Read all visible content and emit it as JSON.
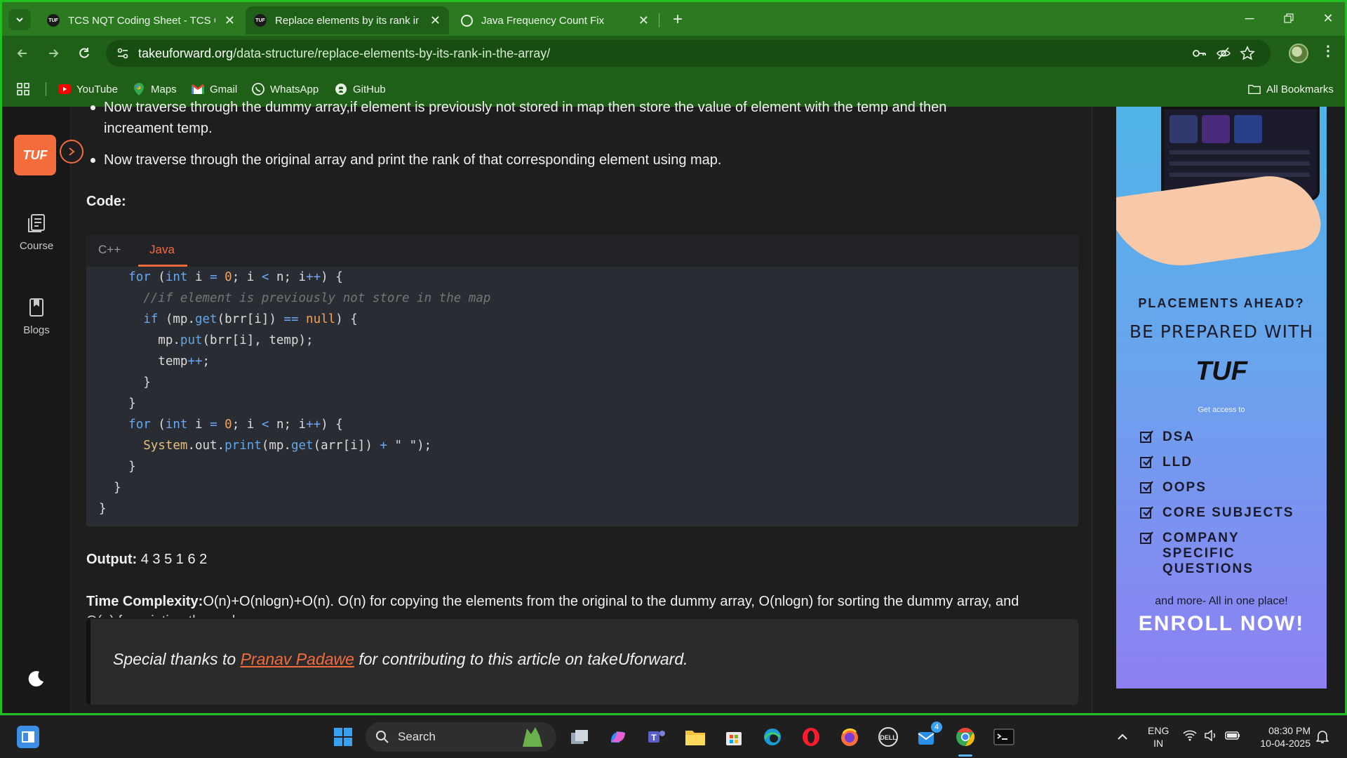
{
  "browser": {
    "tabs": [
      {
        "title": "TCS NQT Coding Sheet - TCS Coding Questions",
        "favicon": "TUF",
        "active": false
      },
      {
        "title": "Replace elements by its rank in the array",
        "favicon": "TUF",
        "active": true
      },
      {
        "title": "Java Frequency Count Fix",
        "favicon": "openai-icon",
        "active": false
      }
    ],
    "url_host": "takeuforward.org",
    "url_path": "/data-structure/replace-elements-by-its-rank-in-the-array/",
    "bookmarks": [
      {
        "label": "YouTube",
        "icon": "youtube-icon"
      },
      {
        "label": "Maps",
        "icon": "maps-icon"
      },
      {
        "label": "Gmail",
        "icon": "gmail-icon"
      },
      {
        "label": "WhatsApp",
        "icon": "whatsapp-icon"
      },
      {
        "label": "GitHub",
        "icon": "github-icon"
      }
    ],
    "all_bookmarks": "All Bookmarks"
  },
  "sidenav": {
    "logo": "TUF",
    "items": [
      {
        "label": "Course"
      },
      {
        "label": "Blogs"
      }
    ]
  },
  "article": {
    "bullet1_line1": "Now traverse through the dummy array,if element is previously not stored in map then store the value of element with the temp and then",
    "bullet1_line2": "increament temp.",
    "bullet2": "Now traverse through the original array and print the rank of that corresponding element using map.",
    "code_heading": "Code:",
    "code_tabs": [
      "C++",
      "Java"
    ],
    "active_code_tab": "Java",
    "output_label": "Output:",
    "output_value": " 4 3 5 1 6 2",
    "tc_label": "Time Complexity:",
    "tc_text": "O(n)+O(nlogn)+O(n). O(n) for copying the elements from the original to the dummy array, O(nlogn) for sorting the dummy array, and",
    "tc_cut": "O(n) for printing the rank",
    "thanks_pre": "Special thanks to ",
    "thanks_link": "Pranav Padawe",
    "thanks_post": " for contributing to this article on takeUforward."
  },
  "ad": {
    "q": "PLACEMENTS AHEAD?",
    "prepared": "BE PREPARED WITH",
    "brand": "TUF",
    "access": "Get access to",
    "items": [
      "DSA",
      "LLD",
      "OOPS",
      "CORE SUBJECTS",
      "COMPANY SPECIFIC QUESTIONS"
    ],
    "more": "and more- All in one place!",
    "cta": "ENROLL NOW!"
  },
  "taskbar": {
    "search": "Search",
    "lang1": "ENG",
    "lang2": "IN",
    "time": "08:30 PM",
    "date": "10-04-2025",
    "teams_badge": "4"
  },
  "colors": {
    "accent": "#f46b3c",
    "chrome_green": "#1f5f17"
  }
}
